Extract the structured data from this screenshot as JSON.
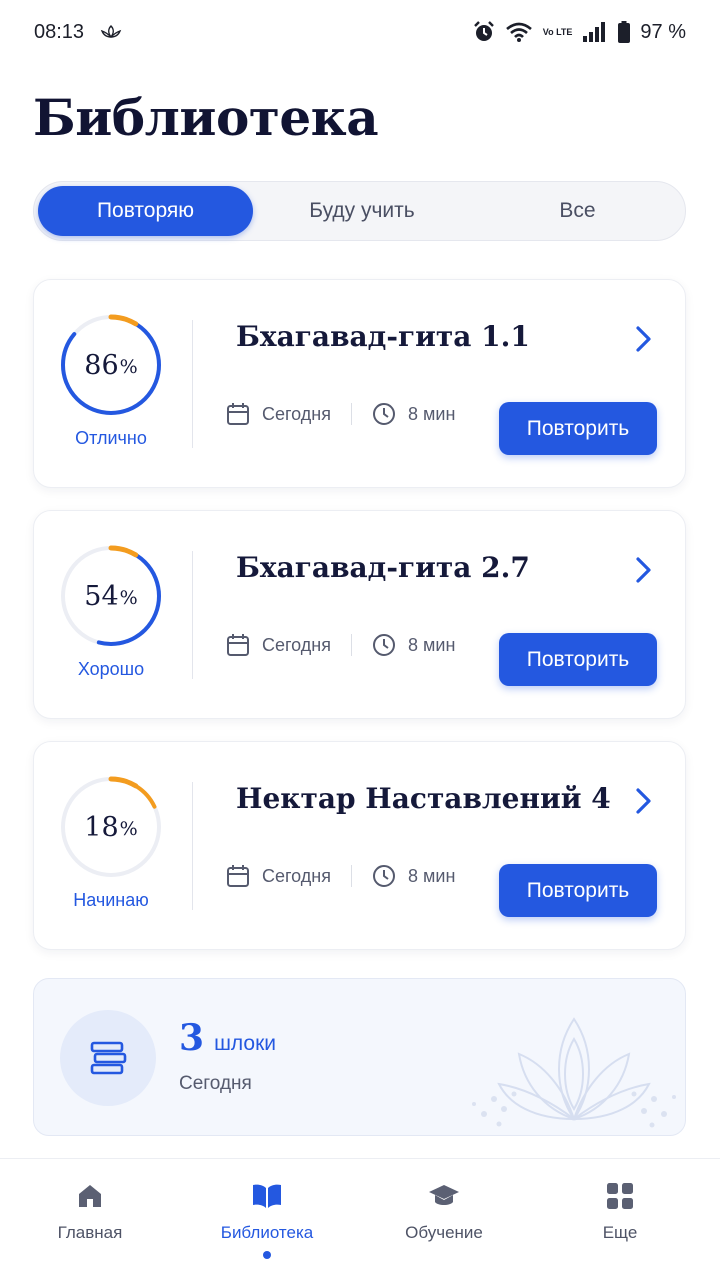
{
  "status_bar": {
    "time": "08:13",
    "network": "Vo LTE",
    "battery": "97 %",
    "icons": [
      "lotus-icon",
      "alarm-icon",
      "wifi-icon",
      "signal-icon",
      "battery-icon"
    ]
  },
  "page": {
    "title": "Библиотека"
  },
  "tabs": [
    {
      "label": "Повторяю",
      "active": true
    },
    {
      "label": "Буду учить",
      "active": false
    },
    {
      "label": "Все",
      "active": false
    }
  ],
  "cards": [
    {
      "title": "Бхагавад-гита 1.1",
      "percent": "86",
      "percent_unit": "%",
      "progress": 0.86,
      "grade": "Отлично",
      "date": "Сегодня",
      "duration": "8 мин",
      "button": "Повторить",
      "arc_color": "#2458e0"
    },
    {
      "title": "Бхагавад-гита 2.7",
      "percent": "54",
      "percent_unit": "%",
      "progress": 0.54,
      "grade": "Хорошо",
      "date": "Сегодня",
      "duration": "8 мин",
      "button": "Повторить",
      "arc_color": "#2458e0"
    },
    {
      "title": "Нектар Наставлений 4",
      "percent": "18",
      "percent_unit": "%",
      "progress": 0.18,
      "grade": "Начинаю",
      "date": "Сегодня",
      "duration": "8 мин",
      "button": "Повторить",
      "arc_color": "#f39c1f"
    }
  ],
  "summary": {
    "count": "3",
    "count_label": "шлоки",
    "subtitle": "Сегодня"
  },
  "nav": [
    {
      "label": "Главная",
      "icon": "home-icon",
      "active": false
    },
    {
      "label": "Библиотека",
      "icon": "book-icon",
      "active": true
    },
    {
      "label": "Обучение",
      "icon": "graduation-cap-icon",
      "active": false
    },
    {
      "label": "Еще",
      "icon": "grid-icon",
      "active": false
    }
  ],
  "colors": {
    "accent": "#2458e0",
    "orange": "#f39c1f",
    "track": "#eceef4"
  }
}
